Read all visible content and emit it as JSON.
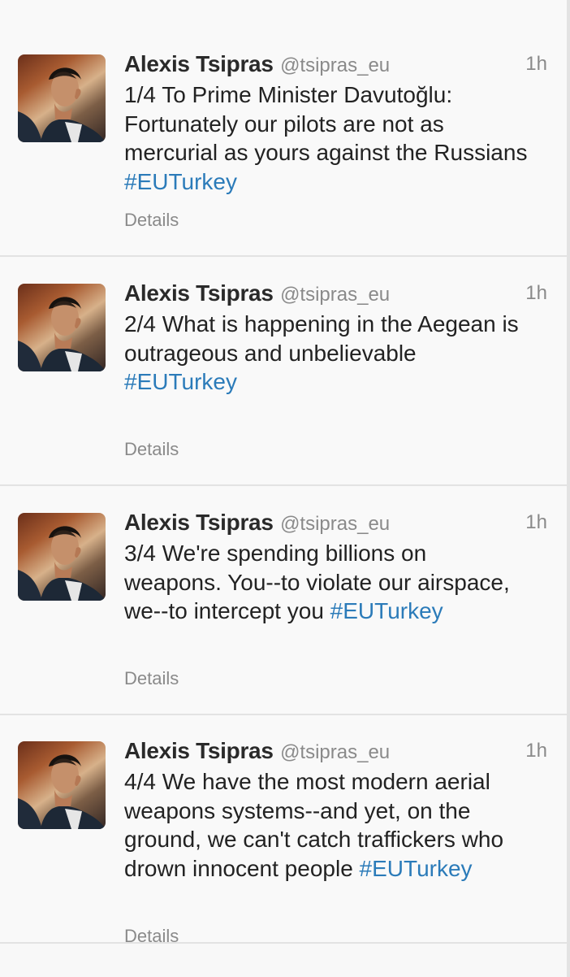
{
  "tweets": [
    {
      "author": "Alexis Tsipras",
      "handle": "@tsipras_eu",
      "time": "1h",
      "text_plain": "1/4 To Prime Minister Davutoğlu:\nFortunately our pilots are not as\nmercurial as yours against the Russians",
      "hashtag": "#EUTurkey",
      "details_label": "Details",
      "hashtag_on_new_line": true
    },
    {
      "author": "Alexis Tsipras",
      "handle": "@tsipras_eu",
      "time": "1h",
      "text_plain": "2/4 What is happening in the Aegean is\noutrageous and unbelievable",
      "hashtag": "#EUTurkey",
      "details_label": "Details",
      "hashtag_on_new_line": true
    },
    {
      "author": "Alexis Tsipras",
      "handle": "@tsipras_eu",
      "time": "1h",
      "text_plain": "3/4 We're spending billions on\nweapons. You--to violate our airspace,\nwe--to intercept you",
      "hashtag": "#EUTurkey",
      "details_label": "Details",
      "hashtag_on_new_line": false
    },
    {
      "author": "Alexis Tsipras",
      "handle": "@tsipras_eu",
      "time": "1h",
      "text_plain": "4/4 We have the most modern aerial\nweapons systems--and yet, on the\nground, we can't catch traffickers who\ndrown innocent people",
      "hashtag": "#EUTurkey",
      "details_label": "Details",
      "hashtag_on_new_line": false
    }
  ],
  "colors": {
    "hashtag": "#2b7bb9",
    "muted": "#8a8a8a",
    "background": "#f9f9f9",
    "divider": "#e3e3e3"
  },
  "icons": {
    "avatar": "profile-photo"
  }
}
